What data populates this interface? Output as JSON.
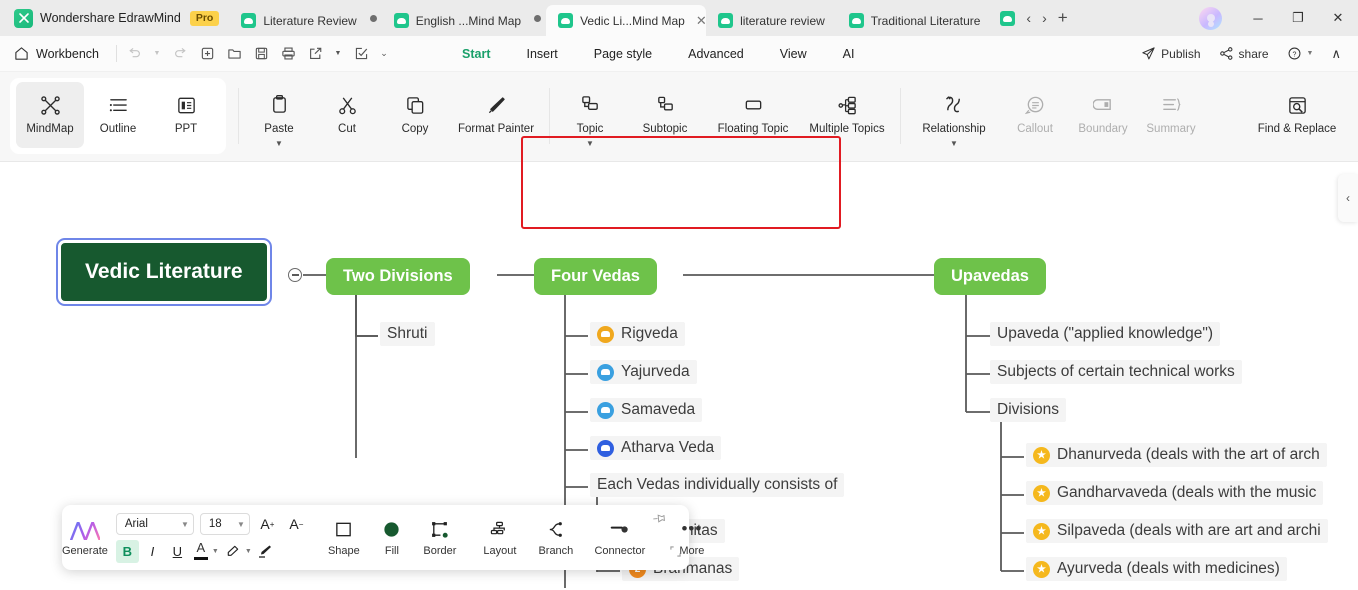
{
  "titlebar": {
    "app_name": "Wondershare EdrawMind",
    "pro_badge": "Pro",
    "tabs": [
      {
        "label": "Literature Review",
        "active": false
      },
      {
        "label": "English ...Mind Map",
        "active": false
      },
      {
        "label": "Vedic Li...Mind Map",
        "active": true
      },
      {
        "label": "literature review",
        "active": false
      },
      {
        "label": "Traditional Literature",
        "active": false
      }
    ],
    "nav_prev": "‹",
    "nav_next": "›",
    "new_tab": "+",
    "minimize": "─",
    "maximize": "❐",
    "close": "✕"
  },
  "menubar": {
    "workbench": "Workbench",
    "quick_access": [
      "undo-icon",
      "undo-caret",
      "redo-icon",
      "new-icon",
      "open-icon",
      "save-icon",
      "print-icon",
      "export-icon",
      "export-caret",
      "edit-icon",
      "more-caret"
    ],
    "menus": [
      {
        "label": "Start",
        "active": true
      },
      {
        "label": "Insert",
        "active": false
      },
      {
        "label": "Page style",
        "active": false
      },
      {
        "label": "Advanced",
        "active": false
      },
      {
        "label": "View",
        "active": false
      },
      {
        "label": "AI",
        "active": false
      }
    ],
    "publish": "Publish",
    "share": "share",
    "help": "?",
    "collapse": "∧"
  },
  "ribbon": {
    "view_group": [
      {
        "label": "MindMap",
        "icon": "mindmap-icon",
        "selected": true
      },
      {
        "label": "Outline",
        "icon": "outline-icon",
        "selected": false
      },
      {
        "label": "PPT",
        "icon": "ppt-icon",
        "selected": false
      }
    ],
    "clipboard_group": [
      {
        "label": "Paste",
        "icon": "paste-icon",
        "caret": true
      },
      {
        "label": "Cut",
        "icon": "cut-icon",
        "caret": false
      },
      {
        "label": "Copy",
        "icon": "copy-icon",
        "caret": false
      },
      {
        "label": "Format Painter",
        "icon": "format-painter-icon",
        "caret": false
      }
    ],
    "topic_group": [
      {
        "label": "Topic",
        "icon": "topic-icon",
        "caret": true
      },
      {
        "label": "Subtopic",
        "icon": "subtopic-icon",
        "caret": false
      },
      {
        "label": "Floating Topic",
        "icon": "floating-topic-icon",
        "caret": false
      },
      {
        "label": "Multiple Topics",
        "icon": "multiple-topics-icon",
        "caret": false
      }
    ],
    "relation_group": [
      {
        "label": "Relationship",
        "icon": "relationship-icon",
        "caret": true,
        "disabled": false
      },
      {
        "label": "Callout",
        "icon": "callout-icon",
        "caret": false,
        "disabled": true
      },
      {
        "label": "Boundary",
        "icon": "boundary-icon",
        "caret": false,
        "disabled": true
      },
      {
        "label": "Summary",
        "icon": "summary-icon",
        "caret": false,
        "disabled": true
      }
    ],
    "find_replace": {
      "label": "Find & Replace",
      "icon": "find-replace-icon"
    },
    "highlight_color": "#e11b22"
  },
  "format_toolbar": {
    "generate": "Generate",
    "font_family": "Arial",
    "font_size": "18",
    "increase_font": "A",
    "decrease_font": "A",
    "bold": "B",
    "italic": "I",
    "underline": "U",
    "font_color": "A",
    "highlight": "highlighter-icon",
    "clear_format": "clear-format-icon",
    "shape": "Shape",
    "fill": "Fill",
    "border": "Border",
    "layout": "Layout",
    "branch": "Branch",
    "connector": "Connector",
    "more": "More",
    "fill_color": "#17592f"
  },
  "mindmap": {
    "root": {
      "label": "Vedic Literature"
    },
    "branches": [
      {
        "label": "Two Divisions"
      },
      {
        "label": "Four Vedas"
      },
      {
        "label": "Upavedas"
      }
    ],
    "two_divisions_children": [
      {
        "label": "Shruti"
      }
    ],
    "four_vedas_children": [
      {
        "label": "Rigveda",
        "marker": "flag",
        "marker_color": "#f0a81e"
      },
      {
        "label": "Yajurveda",
        "marker": "flag",
        "marker_color": "#3aa0e0"
      },
      {
        "label": "Samaveda",
        "marker": "flag",
        "marker_color": "#3aa0e0"
      },
      {
        "label": "Atharva Veda",
        "marker": "flag",
        "marker_color": "#2f5fe0"
      },
      {
        "label": "Each Vedas individually consists of",
        "marker": "none"
      }
    ],
    "each_vedas_children": [
      {
        "label": "Samhitas",
        "marker": "1",
        "marker_color": "#d91f1f"
      },
      {
        "label": "Brahmanas",
        "marker": "2",
        "marker_color": "#f08a1e"
      }
    ],
    "upavedas_children": [
      {
        "label": "Upaveda (\"applied knowledge\")"
      },
      {
        "label": "Subjects of certain technical works"
      },
      {
        "label": "Divisions"
      }
    ],
    "divisions_children": [
      {
        "label": "Dhanurveda (deals with the art of arch",
        "marker": "star",
        "marker_color": "#f5b81d"
      },
      {
        "label": "Gandharvaveda (deals with the music",
        "marker": "star",
        "marker_color": "#f5b81d"
      },
      {
        "label": "Silpaveda (deals with are art and archi",
        "marker": "star",
        "marker_color": "#f5b81d"
      },
      {
        "label": "Ayurveda (deals with medicines)",
        "marker": "star",
        "marker_color": "#f5b81d"
      }
    ],
    "colors": {
      "root_bg": "#17592f",
      "branch_bg": "#6ec24a",
      "leaf_bg": "#f4f4f4",
      "wire": "#5a5a5a",
      "selection": "#6f86e8"
    },
    "panel_toggle": "‹"
  }
}
